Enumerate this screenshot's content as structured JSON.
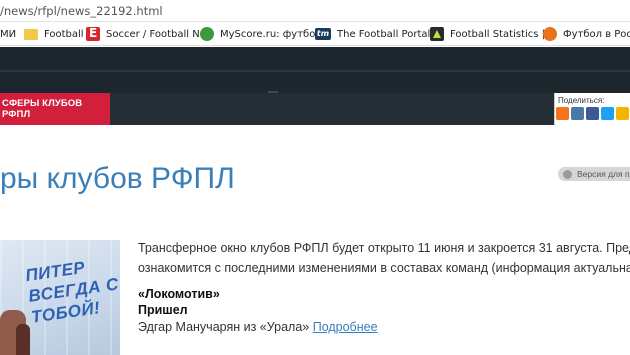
{
  "browser": {
    "url": "/news/rfpl/news_22192.html",
    "bookmarks": [
      {
        "label": "МИ",
        "icon": "bookmark-truncated"
      },
      {
        "label": "Football",
        "icon": "folder-icon"
      },
      {
        "label": "Soccer / Football Ne",
        "icon": "espn-icon"
      },
      {
        "label": "MyScore.ru: футбол",
        "icon": "myscore-icon"
      },
      {
        "label": "The Football Portal f",
        "icon": "transfermarkt-icon"
      },
      {
        "label": "Football Statistics | F",
        "icon": "stats-icon"
      },
      {
        "label": "Футбол в России",
        "icon": "rfpl-icon"
      }
    ]
  },
  "nav": {
    "active_section": "СФЕРЫ КЛУБОВ РФПЛ"
  },
  "share": {
    "label": "Поделиться:",
    "icons": [
      "odnoklassniki-icon",
      "vkontakte-icon",
      "facebook-icon",
      "twitter-icon",
      "yandex-icon"
    ]
  },
  "article": {
    "title": "ры клубов РФПЛ",
    "print_label": "Версия для п",
    "intro_line1": "Трансферное окно клубов РФПЛ будет открыто 11 июня и закроется 31 августа. Предла",
    "intro_line2": "ознакомится с последними изменениями в составах команд (информация актуальна н",
    "club_name": "«Локомотив»",
    "arrived_label": "Пришел",
    "transfer_text": "Эдгар Манучарян из «Урала» ",
    "more_link": "Подробнее",
    "photo_slogan": "ПИТЕР ВСЕГДА С ТОБОЙ!"
  }
}
